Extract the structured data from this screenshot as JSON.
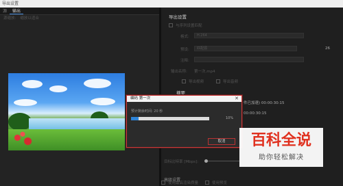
{
  "window": {
    "title": "导出设置"
  },
  "left": {
    "tabs": [
      "源",
      "输出"
    ],
    "source_label": "源缩放:",
    "source_value": "缩放以适合"
  },
  "right": {
    "section_title": "导出设置",
    "match_sequence": "与序列设置匹配",
    "format_label": "格式:",
    "format_value": "H.264",
    "preset_label": "预设:",
    "preset_value": "匹配源",
    "comment_label": "注释:",
    "output_name_label": "输出名称:",
    "output_name_value": "第一次.mp4",
    "export_video": "导出视频",
    "export_audio": "导出音频",
    "summary_title": "摘要",
    "summary_lines": [
      "件已加速) 00:00:30:15",
      "00:00:30:15"
    ],
    "side_value": "26",
    "bitrate_label": "目标比特率 [Mbps]:",
    "advanced_title": "高级设置",
    "bottom_checks": [
      "使用最高渲染质量",
      "使用预览"
    ]
  },
  "dialog": {
    "title": "编码 第一次",
    "message": "预计剩余时间: 20 秒",
    "progress_percent": 10,
    "percent_text": "10%",
    "cancel_label": "取消"
  },
  "watermark": {
    "main": "百科全说",
    "sub": "助你轻松解决"
  },
  "colors": {
    "accent": "#2e84d8",
    "dialog_border": "#c93a3a",
    "watermark_red": "#e0301e"
  }
}
